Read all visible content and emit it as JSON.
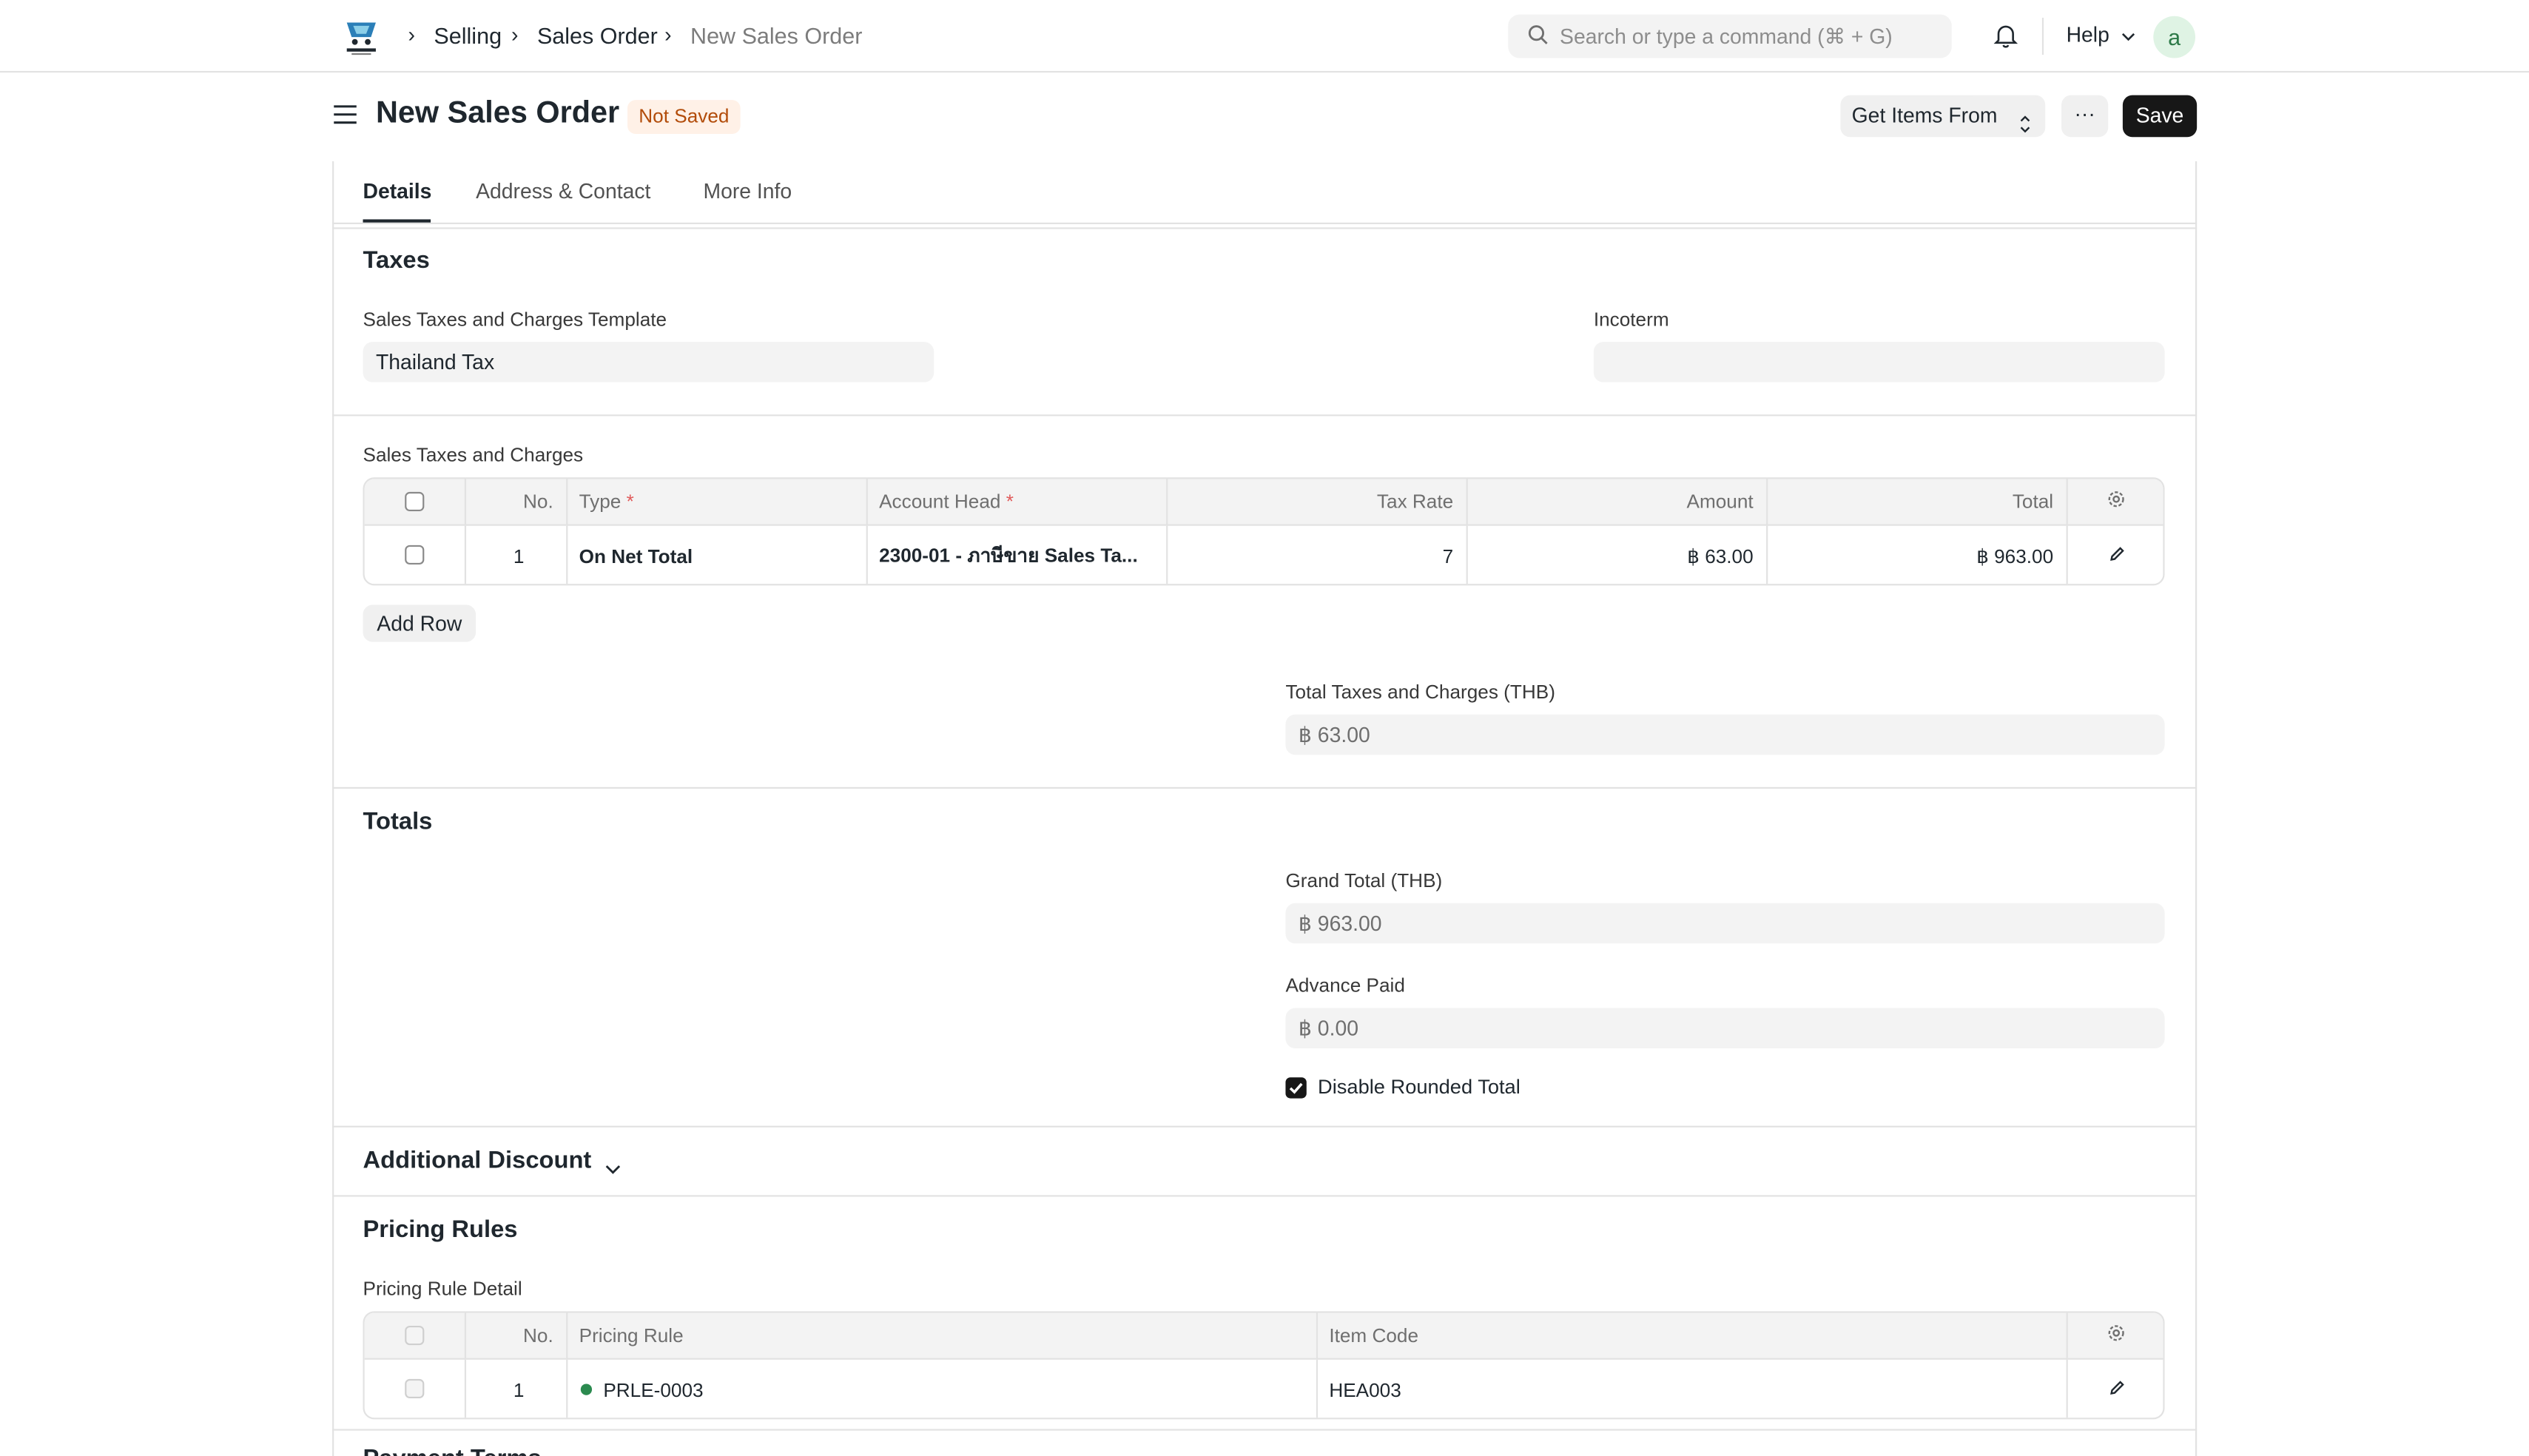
{
  "navbar": {
    "breadcrumbs": [
      "Selling",
      "Sales Order",
      "New Sales Order"
    ],
    "search_placeholder": "Search or type a command (⌘ + G)",
    "help_label": "Help",
    "avatar_letter": "a"
  },
  "page": {
    "title": "New Sales Order",
    "status": "Not Saved",
    "get_items_label": "Get Items From",
    "more_label": "···",
    "save_label": "Save"
  },
  "tabs": [
    "Details",
    "Address & Contact",
    "More Info"
  ],
  "taxes": {
    "title": "Taxes",
    "template_label": "Sales Taxes and Charges Template",
    "template_value": "Thailand Tax",
    "incoterm_label": "Incoterm",
    "incoterm_value": "",
    "table_label": "Sales Taxes and Charges",
    "columns": [
      "No.",
      "Type",
      "Account Head",
      "Tax Rate",
      "Amount",
      "Total"
    ],
    "rows": [
      {
        "no": "1",
        "type": "On Net Total",
        "account_head": "2300-01 - ภาษีขาย Sales Ta...",
        "tax_rate": "7",
        "amount": "฿ 63.00",
        "total": "฿ 963.00"
      }
    ],
    "add_row_label": "Add Row",
    "total_label": "Total Taxes and Charges (THB)",
    "total_value": "฿ 63.00"
  },
  "totals": {
    "title": "Totals",
    "grand_total_label": "Grand Total (THB)",
    "grand_total_value": "฿ 963.00",
    "advance_paid_label": "Advance Paid",
    "advance_paid_value": "฿ 0.00",
    "disable_rounded_label": "Disable Rounded Total"
  },
  "additional_discount": {
    "title": "Additional Discount"
  },
  "pricing_rules": {
    "title": "Pricing Rules",
    "table_label": "Pricing Rule Detail",
    "columns": [
      "No.",
      "Pricing Rule",
      "Item Code"
    ],
    "rows": [
      {
        "no": "1",
        "pricing_rule": "PRLE-0003",
        "item_code": "HEA003"
      }
    ]
  },
  "next_section": {
    "title": "Payment Terms"
  },
  "colors": {
    "accent": "#171717",
    "status_badge_bg": "#fff1e7",
    "status_badge_text": "#b24c0a",
    "active_dot": "#2b8a4f"
  }
}
